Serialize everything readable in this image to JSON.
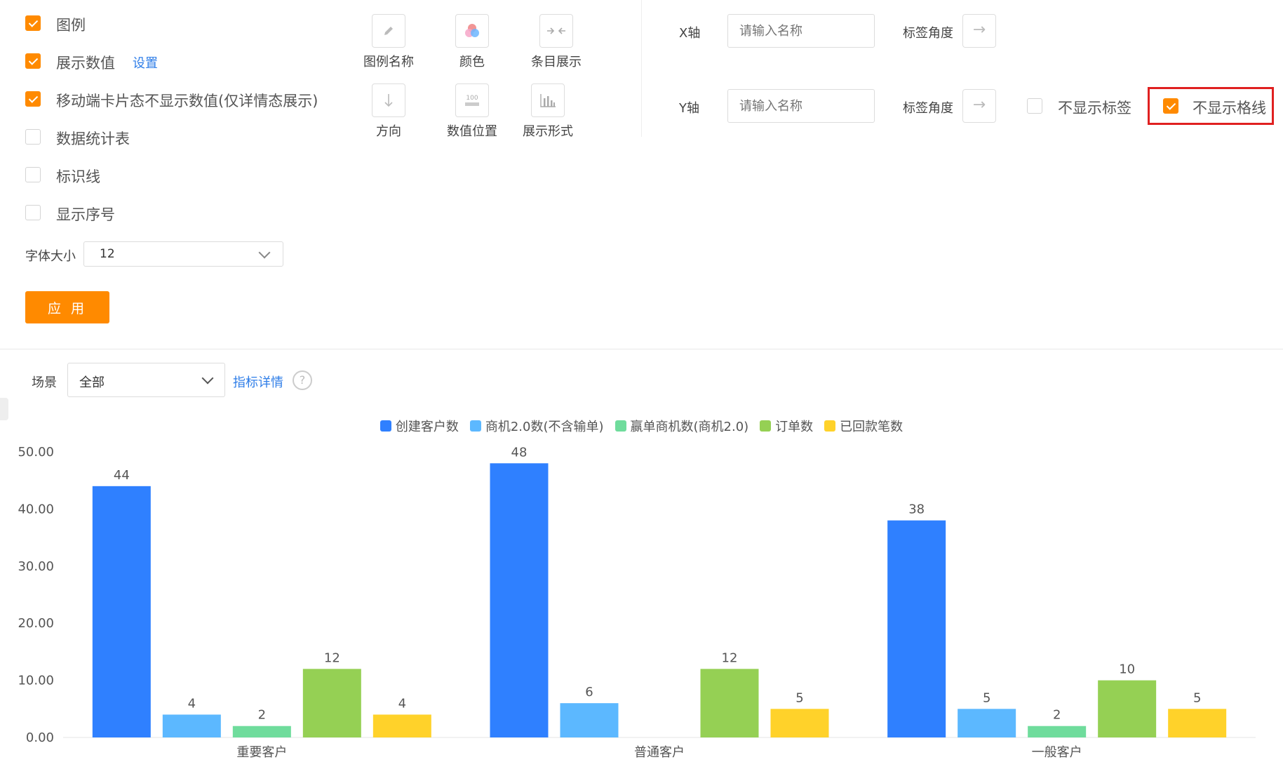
{
  "options": {
    "items": [
      {
        "label": "图例",
        "checked": true
      },
      {
        "label": "展示数值",
        "checked": true
      },
      {
        "label": "移动端卡片态不显示数值(仅详情态展示)",
        "checked": true
      },
      {
        "label": "数据统计表",
        "checked": false
      },
      {
        "label": "标识线",
        "checked": false
      },
      {
        "label": "显示序号",
        "checked": false
      }
    ],
    "settings_link": "设置",
    "font_size_label": "字体大小",
    "font_size_value": "12",
    "apply_label": "应 用"
  },
  "tools": [
    {
      "label": "图例名称",
      "icon": "pencil-icon"
    },
    {
      "label": "颜色",
      "icon": "color-palette-icon"
    },
    {
      "label": "条目展示",
      "icon": "collapse-arrows-icon"
    },
    {
      "label": "方向",
      "icon": "arrow-down-icon"
    },
    {
      "label": "数值位置",
      "icon": "value-position-icon"
    },
    {
      "label": "展示形式",
      "icon": "bar-chart-icon"
    }
  ],
  "axis": {
    "x_label": "X轴",
    "y_label": "Y轴",
    "name_placeholder": "请输入名称",
    "tag_angle_label": "标签角度",
    "hide_labels": "不显示标签",
    "hide_labels_checked": false,
    "hide_gridlines": "不显示格线",
    "hide_gridlines_checked": true
  },
  "filter": {
    "scene_label": "场景",
    "scene_value": "全部",
    "metric_details_link": "指标详情"
  },
  "colors": {
    "accent": "#ff8a00",
    "link": "#2f7ee8",
    "highlight": "#e02020"
  },
  "chart_data": {
    "type": "bar",
    "categories": [
      "重要客户",
      "普通客户",
      "一般客户"
    ],
    "series": [
      {
        "name": "创建客户数",
        "color": "#2f80ff",
        "values": [
          44,
          48,
          38
        ]
      },
      {
        "name": "商机2.0数(不含输单)",
        "color": "#5cb8ff",
        "values": [
          4,
          6,
          5
        ]
      },
      {
        "name": "赢单商机数(商机2.0)",
        "color": "#6fdc9c",
        "values": [
          2,
          0,
          2
        ]
      },
      {
        "name": "订单数",
        "color": "#95d054",
        "values": [
          12,
          12,
          10
        ]
      },
      {
        "name": "已回款笔数",
        "color": "#ffd22a",
        "values": [
          4,
          5,
          5
        ]
      }
    ],
    "yticks": [
      "0.00",
      "10.00",
      "20.00",
      "30.00",
      "40.00",
      "50.00"
    ],
    "ylim": [
      0,
      50
    ],
    "grid": false,
    "legend_position": "top-center"
  }
}
